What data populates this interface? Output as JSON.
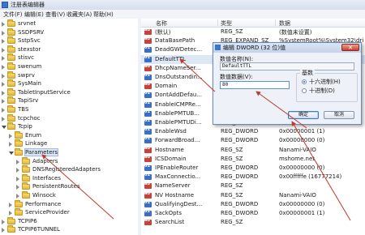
{
  "window": {
    "title": "注册表编辑器"
  },
  "menu": [
    "文件(F)",
    "编辑(E)",
    "查看(V)",
    "收藏夹(A)",
    "帮助(H)"
  ],
  "tree": {
    "items": [
      {
        "label": "srvnet",
        "level": 0,
        "expanded": false
      },
      {
        "label": "SSDPSRV",
        "level": 0,
        "expanded": false
      },
      {
        "label": "SstpSvc",
        "level": 0,
        "expanded": false
      },
      {
        "label": "stexstor",
        "level": 0,
        "expanded": false
      },
      {
        "label": "stisvc",
        "level": 0,
        "expanded": false
      },
      {
        "label": "swenum",
        "level": 0,
        "expanded": false
      },
      {
        "label": "swprv",
        "level": 0,
        "expanded": false
      },
      {
        "label": "SysMain",
        "level": 0,
        "expanded": false
      },
      {
        "label": "TabletInputService",
        "level": 0,
        "expanded": false
      },
      {
        "label": "TapiSrv",
        "level": 0,
        "expanded": false
      },
      {
        "label": "TBS",
        "level": 0,
        "expanded": false
      },
      {
        "label": "tcpchoc",
        "level": 0,
        "expanded": false
      },
      {
        "label": "Tcpip",
        "level": 0,
        "expanded": true
      },
      {
        "label": "Enum",
        "level": 1,
        "expanded": false
      },
      {
        "label": "Linkage",
        "level": 1,
        "expanded": false
      },
      {
        "label": "Parameters",
        "level": 1,
        "expanded": true,
        "selected": true
      },
      {
        "label": "Adapters",
        "level": 2,
        "expanded": false
      },
      {
        "label": "DNSRegisteredAdapters",
        "level": 2,
        "expanded": false
      },
      {
        "label": "Interfaces",
        "level": 2,
        "expanded": false
      },
      {
        "label": "PersistentRoutes",
        "level": 2,
        "expanded": false
      },
      {
        "label": "Winsock",
        "level": 2,
        "expanded": false
      },
      {
        "label": "Performance",
        "level": 1,
        "expanded": false
      },
      {
        "label": "ServiceProvider",
        "level": 1,
        "expanded": false
      },
      {
        "label": "TCPIP6",
        "level": 0,
        "expanded": false
      },
      {
        "label": "TCPIP6TUNNEL",
        "level": 0,
        "expanded": false
      }
    ]
  },
  "list": {
    "columns": [
      "名称",
      "类型",
      "数据"
    ],
    "rows": [
      {
        "icon": "sz",
        "name": "(默认)",
        "type": "REG_SZ",
        "data": "(数值未设置)"
      },
      {
        "icon": "sz",
        "name": "DataBasePath",
        "type": "REG_EXPAND_SZ",
        "data": "%SystemRoot%\\System32\\drivers\\etc"
      },
      {
        "icon": "dw",
        "name": "DeadGWDetec...",
        "type": "REG_DWORD",
        "data": ""
      },
      {
        "icon": "dw",
        "name": "DefaultTTL",
        "type": "REG_DWORD",
        "data": "",
        "selected": true
      },
      {
        "icon": "sz",
        "name": "DhcpNameSer...",
        "type": "REG_SZ",
        "data": ""
      },
      {
        "icon": "dw",
        "name": "DnsOutstandin...",
        "type": "REG_DWORD",
        "data": ""
      },
      {
        "icon": "sz",
        "name": "Domain",
        "type": "REG_SZ",
        "data": ""
      },
      {
        "icon": "dw",
        "name": "DontAddDefau...",
        "type": "REG_DWORD",
        "data": ""
      },
      {
        "icon": "dw",
        "name": "EnableICMPRe...",
        "type": "REG_DWORD",
        "data": ""
      },
      {
        "icon": "dw",
        "name": "EnablePMTUB...",
        "type": "REG_DWORD",
        "data": ""
      },
      {
        "icon": "dw",
        "name": "EnablePMTUDi...",
        "type": "REG_DWORD",
        "data": ""
      },
      {
        "icon": "dw",
        "name": "EnableWsd",
        "type": "REG_DWORD",
        "data": "0x00000001 (1)"
      },
      {
        "icon": "dw",
        "name": "ForwardBroad...",
        "type": "REG_DWORD",
        "data": "0x00000000 (0)"
      },
      {
        "icon": "sz",
        "name": "Hostname",
        "type": "REG_SZ",
        "data": "Nanami-VAIO"
      },
      {
        "icon": "sz",
        "name": "ICSDomain",
        "type": "REG_SZ",
        "data": "mshome.net"
      },
      {
        "icon": "dw",
        "name": "IPEnableRouter",
        "type": "REG_DWORD",
        "data": "0x00000000 (0)"
      },
      {
        "icon": "dw",
        "name": "MaxConnectio...",
        "type": "REG_DWORD",
        "data": "0x00fffffe (16777214)"
      },
      {
        "icon": "sz",
        "name": "NameServer",
        "type": "REG_SZ",
        "data": ""
      },
      {
        "icon": "sz",
        "name": "NV Hostname",
        "type": "REG_SZ",
        "data": "Nanami-VAIO"
      },
      {
        "icon": "dw",
        "name": "QualifyingDest...",
        "type": "REG_DWORD",
        "data": "0x00000000 (0)"
      },
      {
        "icon": "dw",
        "name": "SackOpts",
        "type": "REG_DWORD",
        "data": "0x00000001 (1)"
      },
      {
        "icon": "sz",
        "name": "SearchList",
        "type": "REG_SZ",
        "data": ""
      }
    ]
  },
  "dialog": {
    "title": "编辑 DWORD (32 位)值",
    "close_label": "✕",
    "name_label": "数值名称(N):",
    "name_value": "DefaultTTL",
    "data_label": "数值数据(V):",
    "data_value": "80",
    "base_label": "基数",
    "hex_label": "十六进制(H)",
    "dec_label": "十进制(D)",
    "selected_base": "hex",
    "ok_label": "确定",
    "cancel_label": "取消"
  },
  "colors": {
    "annotation": "#c0392b"
  }
}
